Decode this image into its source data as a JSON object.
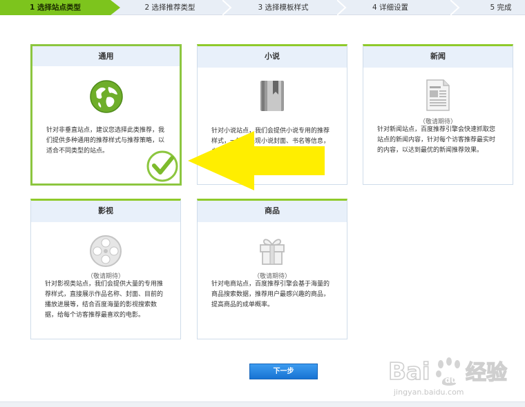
{
  "steps": [
    {
      "label": "1 选择站点类型",
      "active": true
    },
    {
      "label": "2 选择推荐类型",
      "active": false
    },
    {
      "label": "3 选择模板样式",
      "active": false
    },
    {
      "label": "4 详细设置",
      "active": false
    },
    {
      "label": "5 完成",
      "active": false
    }
  ],
  "cards": {
    "general": {
      "title": "通用",
      "icon": "globe-icon",
      "subtitle": "",
      "desc": "针对非垂直站点，建议您选择此类推荐，我们提供多种通用的推荐样式与推荐策略，以适合不同类型的站点。",
      "selected": true
    },
    "novel": {
      "title": "小说",
      "icon": "book-icon",
      "subtitle": "",
      "desc": "针对小说站点，我们会提供小说专用的推荐样式，一键接展现小说封面、书名等信息，书名…（部分被遮挡）…",
      "selected": false
    },
    "news": {
      "title": "新闻",
      "icon": "newspaper-icon",
      "subtitle": "（敬请期待）",
      "desc": "针对新闻站点，百度推荐引擎会快速抓取您站点的新闻内容，针对每个访客推荐最实时的内容，以达到最优的新闻推荐效果。",
      "selected": false
    },
    "video": {
      "title": "影视",
      "icon": "film-reel-icon",
      "subtitle": "（敬请期待）",
      "desc": "针对影视类站点，我们会提供大量的专用推荐样式，直接展示作品名称、封面、目前的播放进展等，结合百度海量的影视搜索数据，给每个访客推荐最喜欢的电影。",
      "selected": false
    },
    "goods": {
      "title": "商品",
      "icon": "gift-icon",
      "subtitle": "（敬请期待）",
      "desc": "针对电商站点，百度推荐引擎会基于海量的商品搜索数据，推荐用户最感兴趣的商品，提高商品的成单概率。",
      "selected": false
    }
  },
  "next_button": "下一步",
  "watermark": {
    "brand": "Bai du 经验",
    "url": "jingyan.baidu.com"
  },
  "colors": {
    "accent_green": "#8cc63f",
    "header_bg": "#e8f0fa",
    "button_blue": "#1e7fdc",
    "arrow_yellow": "#ffee00"
  }
}
